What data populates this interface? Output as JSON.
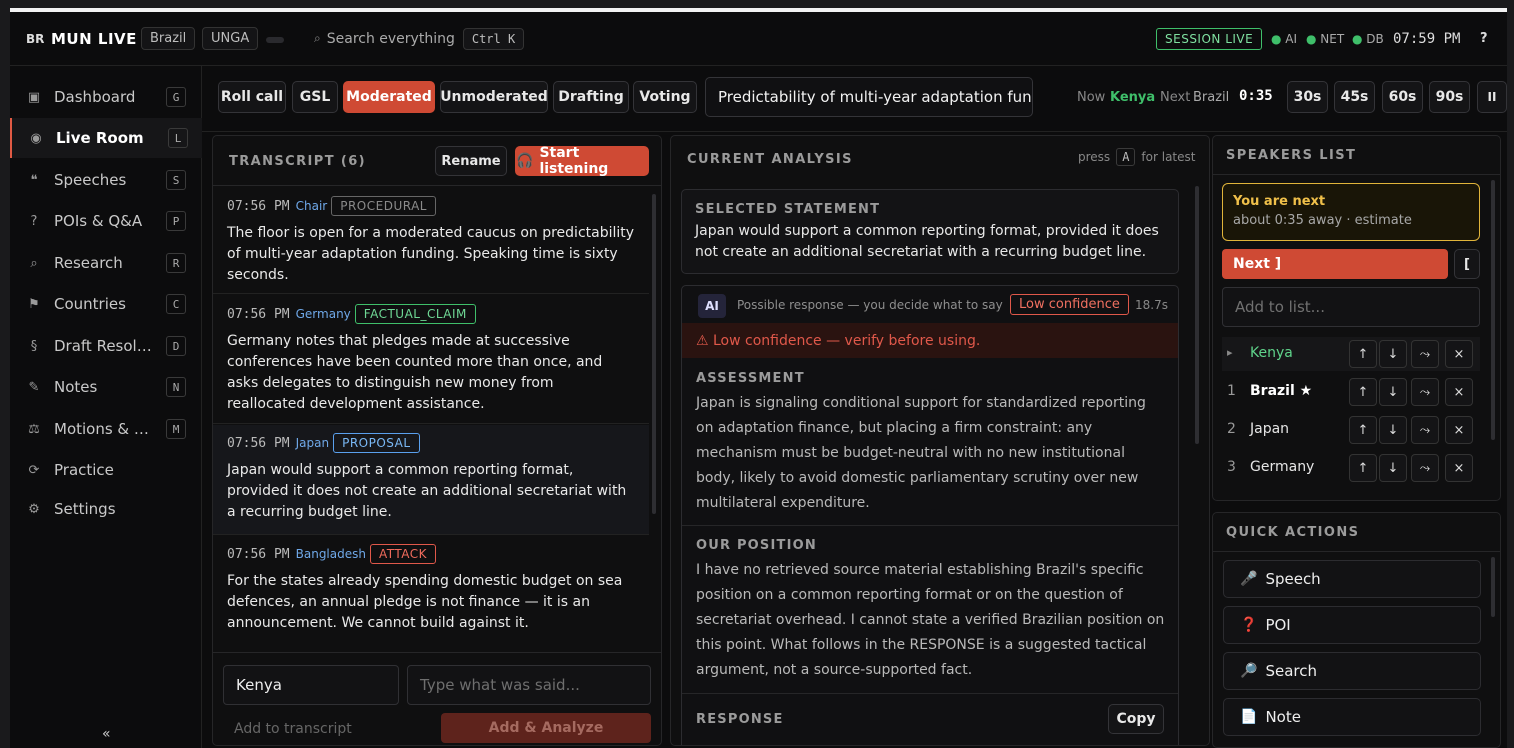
{
  "app": {
    "badge": "BR",
    "name": "MUN LIVE",
    "country": "Brazil",
    "committee": "UNGA"
  },
  "search": {
    "label": "Search everything",
    "shortcut": "Ctrl K"
  },
  "status": {
    "session": "SESSION LIVE",
    "ai": "AI",
    "net": "NET",
    "db": "DB",
    "time": "07:59 PM",
    "help": "?",
    "ok_color": "#3fbf6a"
  },
  "sidebar": {
    "items": [
      {
        "icon": "▣",
        "label": "Dashboard",
        "key": "G"
      },
      {
        "icon": "◉",
        "label": "Live Room",
        "key": "L"
      },
      {
        "icon": "❝",
        "label": "Speeches",
        "key": "S"
      },
      {
        "icon": "?",
        "label": "POIs & Q&A",
        "key": "P"
      },
      {
        "icon": "⌕",
        "label": "Research",
        "key": "R"
      },
      {
        "icon": "⚑",
        "label": "Countries",
        "key": "C"
      },
      {
        "icon": "§",
        "label": "Draft Resolut...",
        "key": "D"
      },
      {
        "icon": "✎",
        "label": "Notes",
        "key": "N"
      },
      {
        "icon": "⚖",
        "label": "Motions & R...",
        "key": "M"
      },
      {
        "icon": "⟳",
        "label": "Practice",
        "key": ""
      },
      {
        "icon": "⚙",
        "label": "Settings",
        "key": ""
      }
    ],
    "collapse": "«"
  },
  "modes": [
    "Roll call",
    "GSL",
    "Moderated",
    "Unmoderated",
    "Drafting",
    "Voting"
  ],
  "topic": "Predictability of multi-year adaptation fundin",
  "timer": {
    "now_label": "Now",
    "now": "Kenya",
    "next_label": "Next",
    "next": "Brazil",
    "remaining": "0:35",
    "presets": [
      "30s",
      "45s",
      "60s",
      "90s"
    ],
    "pause": "II"
  },
  "transcript": {
    "title": "TRANSCRIPT (6)",
    "rename": "Rename",
    "listen": "Start listening",
    "entries": [
      {
        "time": "07:56 PM",
        "speaker": "Chair",
        "tag": "PROCEDURAL",
        "tag_color": "#8a8a8a",
        "text": "The floor is open for a moderated caucus on predictability of multi-year adaptation funding. Speaking time is sixty seconds."
      },
      {
        "time": "07:56 PM",
        "speaker": "Germany",
        "tag": "FACTUAL_CLAIM",
        "tag_color": "#3fbf6a",
        "text": "Germany notes that pledges made at successive conferences have been counted more than once, and asks delegates to distinguish new money from reallocated development assistance."
      },
      {
        "time": "07:56 PM",
        "speaker": "Japan",
        "tag": "PROPOSAL",
        "tag_color": "#5aa0ee",
        "text": "Japan would support a common reporting format, provided it does not create an additional secretariat with a recurring budget line."
      },
      {
        "time": "07:56 PM",
        "speaker": "Bangladesh",
        "tag": "ATTACK",
        "tag_color": "#e0584a",
        "text": "For the states already spending domestic budget on sea defences, an annual pledge is not finance — it is an announcement. We cannot build against it."
      }
    ],
    "speaker_value": "Kenya",
    "input_placeholder": "Type what was said...",
    "add_label": "Add to transcript",
    "analyze_label": "Add & Analyze"
  },
  "analysis": {
    "title": "CURRENT ANALYSIS",
    "hint_pre": "press",
    "hint_key": "A",
    "hint_post": "for latest",
    "selected_title": "SELECTED STATEMENT",
    "selected_text": "Japan would support a common reporting format, provided it does not create an additional secretariat with a recurring budget line.",
    "ai_badge": "AI",
    "ai_note": "Possible response — you decide what to say",
    "confidence": "Low confidence",
    "elapsed": "18.7s",
    "warning": "⚠ Low confidence — verify before using.",
    "assessment_title": "ASSESSMENT",
    "assessment_text": "Japan is signaling conditional support for standardized reporting on adaptation finance, but placing a firm constraint: any mechanism must be budget-neutral with no new institutional body, likely to avoid domestic parliamentary scrutiny over new multilateral expenditure.",
    "position_title": "OUR POSITION",
    "position_text": "I have no retrieved source material establishing Brazil's specific position on a common reporting format or on the question of secretariat overhead. I cannot state a verified Brazilian position on this point. What follows in the RESPONSE is a suggested tactical argument, not a source-supported fact.",
    "response_title": "RESPONSE",
    "copy": "Copy"
  },
  "speakers": {
    "title": "SPEAKERS LIST",
    "next_title": "You are next",
    "next_sub": "about 0:35 away · estimate",
    "next_btn": "Next ]",
    "bracket_btn": "[",
    "add_placeholder": "Add to list...",
    "list": [
      {
        "num": "▸",
        "name": "Kenya"
      },
      {
        "num": "1",
        "name": "Brazil ★"
      },
      {
        "num": "2",
        "name": "Japan"
      },
      {
        "num": "3",
        "name": "Germany"
      }
    ],
    "row_actions": [
      "↑",
      "↓",
      "⤳",
      "×"
    ]
  },
  "quick": {
    "title": "QUICK ACTIONS",
    "items": [
      {
        "icon": "🎤",
        "label": "Speech"
      },
      {
        "icon": "❓",
        "label": "POI"
      },
      {
        "icon": "🔎",
        "label": "Search"
      },
      {
        "icon": "📄",
        "label": "Note"
      }
    ]
  }
}
